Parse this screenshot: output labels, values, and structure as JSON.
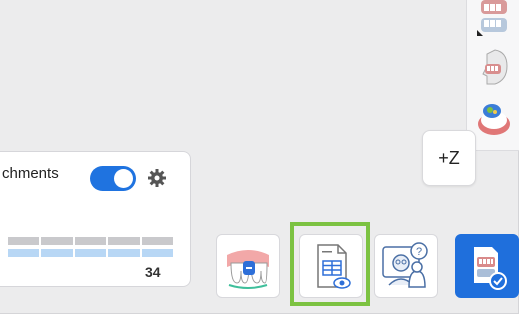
{
  "attachments_panel": {
    "label": "chments",
    "toggle_on": true,
    "count": "34"
  },
  "axis_button": {
    "label": "+Z"
  },
  "tool_strip": {
    "icons": [
      "jaw-model-icon",
      "face-scan-icon",
      "crown-color-icon"
    ]
  },
  "bottom_toolbar": {
    "buttons": [
      "tooth-gap-icon",
      "report-preview-icon",
      "doctor-question-icon",
      "case-approved-icon"
    ],
    "selected": "report-preview-icon"
  },
  "colors": {
    "accent": "#1f73e0",
    "selected": "#7cc242",
    "panel_bg": "#ececed"
  }
}
